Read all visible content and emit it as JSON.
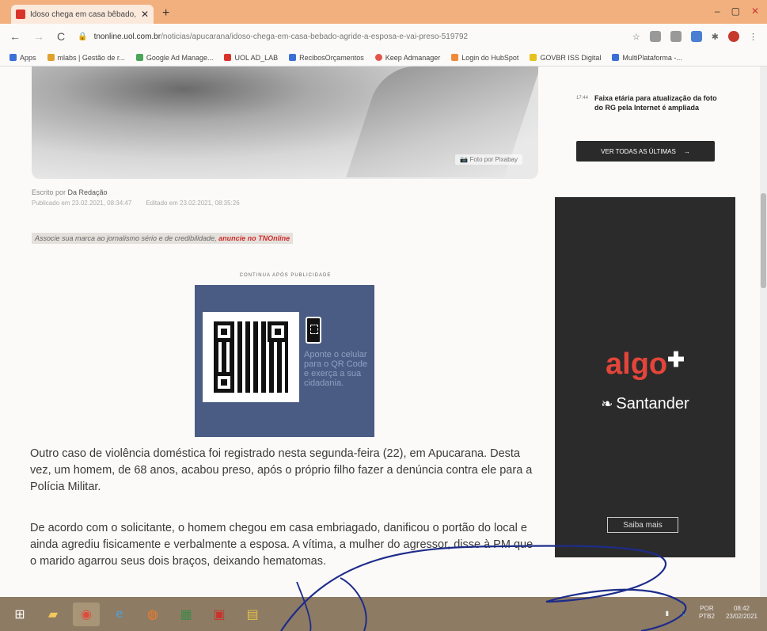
{
  "browser": {
    "tab_title": "Idoso chega em casa bêbado, ag",
    "tab_close": "✕",
    "new_tab": "+",
    "url_domain": "tnonline.uol.com.br",
    "url_path": "/noticias/apucarana/idoso-chega-em-casa-bebado-agride-a-esposa-e-vai-preso-519792",
    "window_controls": [
      "–",
      "▢",
      "✕"
    ],
    "bookmarks": [
      "Apps",
      "mlabs | Gestão de r...",
      "Google Ad Manage...",
      "UOL AD_LAB",
      "RecibosOrçamentos",
      "Keep Admanager",
      "Login do HubSpot",
      "GOVBR ISS Digital",
      "MultiPlataforma -..."
    ]
  },
  "article": {
    "photo_credit": "Foto por Pixabay",
    "author_prefix": "Escrito por",
    "author": "Da Redação",
    "published": "Publicado em 23.02.2021, 08:34:47",
    "edited": "Editado em 23.02.2021, 08:35:26",
    "promo_text": "Associe sua marca ao jornalismo sério e de credibilidade,",
    "promo_link": "anuncie no TNOnline",
    "ad_label": "CONTINUA APÓS PUBLICIDADE",
    "qr_text": "Aponte o celular para o QR Code e exerça a sua cidadania.",
    "paragraph1": "Outro caso de violência doméstica foi registrado nesta segunda-feira (22), em Apucarana. Desta vez, um homem, de 68 anos, acabou preso, após o próprio filho fazer a denúncia contra ele para a Polícia Militar.",
    "paragraph2": "De acordo com o solicitante, o homem chegou em casa embriagado, danificou o portão do local e ainda agrediu fisicamente e verbalmente a esposa. A vítima, a mulher do agressor, disse à PM que o marido agarrou seus dois braços, deixando hematomas."
  },
  "sidebar": {
    "news_time": "17:44",
    "news_headline": "Faixa etária para atualização da foto do RG pela Internet é ampliada",
    "see_all": "VER TODAS AS ÚLTIMAS",
    "ad_brand": "algo",
    "ad_sponsor": "Santander",
    "ad_cta": "Saiba mais"
  },
  "taskbar": {
    "lang_top": "POR",
    "lang_bottom": "PTB2",
    "time": "08:42",
    "date": "23/02/2021"
  }
}
